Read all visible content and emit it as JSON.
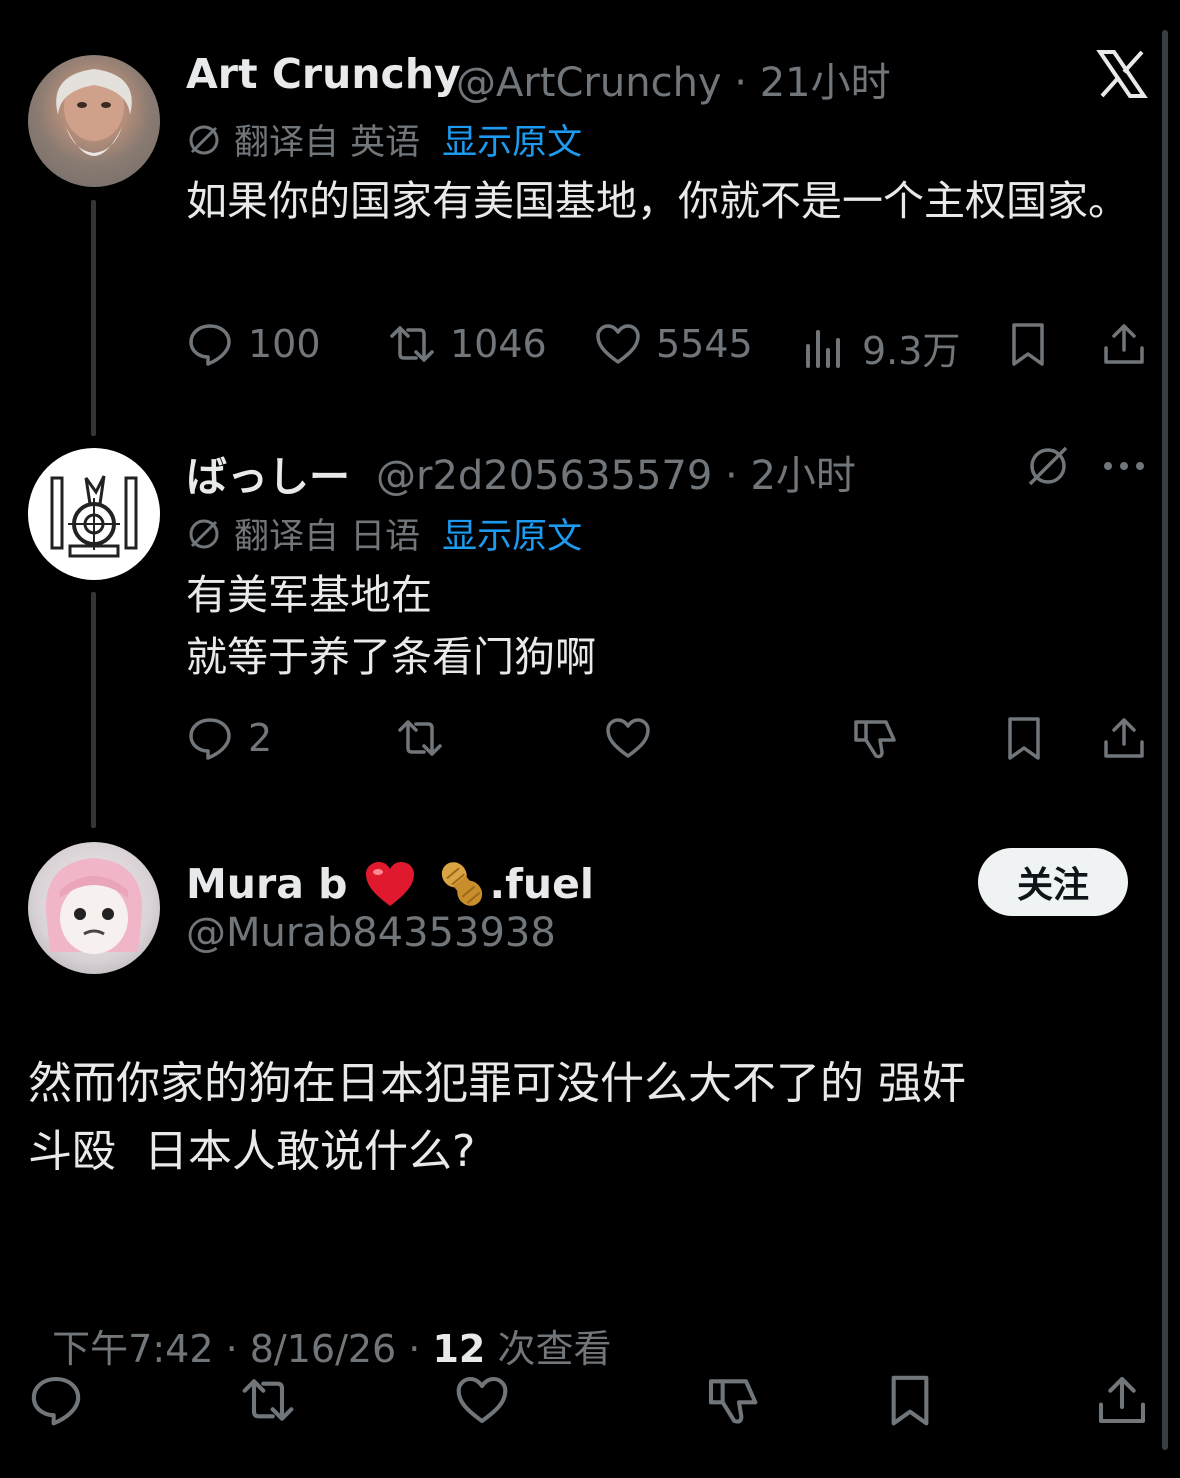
{
  "close_glyph": "X",
  "tweet1": {
    "name": "Art Crunchy",
    "handle_time": "@ArtCrunchy · 21小时",
    "translated": "翻译自 英语",
    "show_original": "显示原文",
    "text": "如果你的国家有美国基地，你就不是一个主权国家。",
    "replies": "100",
    "retweets": "1046",
    "likes": "5545",
    "views": "9.3万"
  },
  "tweet2": {
    "name": "ばっしー",
    "handle_time": "@r2d205635579 · 2小时",
    "translated": "翻译自 日语",
    "show_original": "显示原文",
    "text_line1": "有美军基地在",
    "text_line2": "就等于养了条看门狗啊",
    "replies": "2"
  },
  "main_tweet": {
    "name": "Mura b",
    "name_suffix": ".fuel",
    "handle": "@Murab84353938",
    "follow_label": "关注",
    "text_line1": "然而你家的狗在日本犯罪可没什么大不了的 强奸",
    "text_line2": "斗殴  日本人敢说什么?",
    "time": "下午7:42 · 8/16/26 · ",
    "view_count": "12",
    "view_label": " 次查看"
  },
  "colors": {
    "background": "#000000",
    "text": "#e7e9ea",
    "muted": "#71767b",
    "link": "#1d9bf0",
    "heart_emoji": "#e0192f"
  },
  "icons": [
    "x-logo-icon",
    "translate-icon",
    "reply-icon",
    "retweet-icon",
    "like-icon",
    "views-icon",
    "bookmark-icon",
    "share-icon",
    "more-icon",
    "grok-icon",
    "heart-emoji-icon",
    "peanut-emoji-icon"
  ]
}
